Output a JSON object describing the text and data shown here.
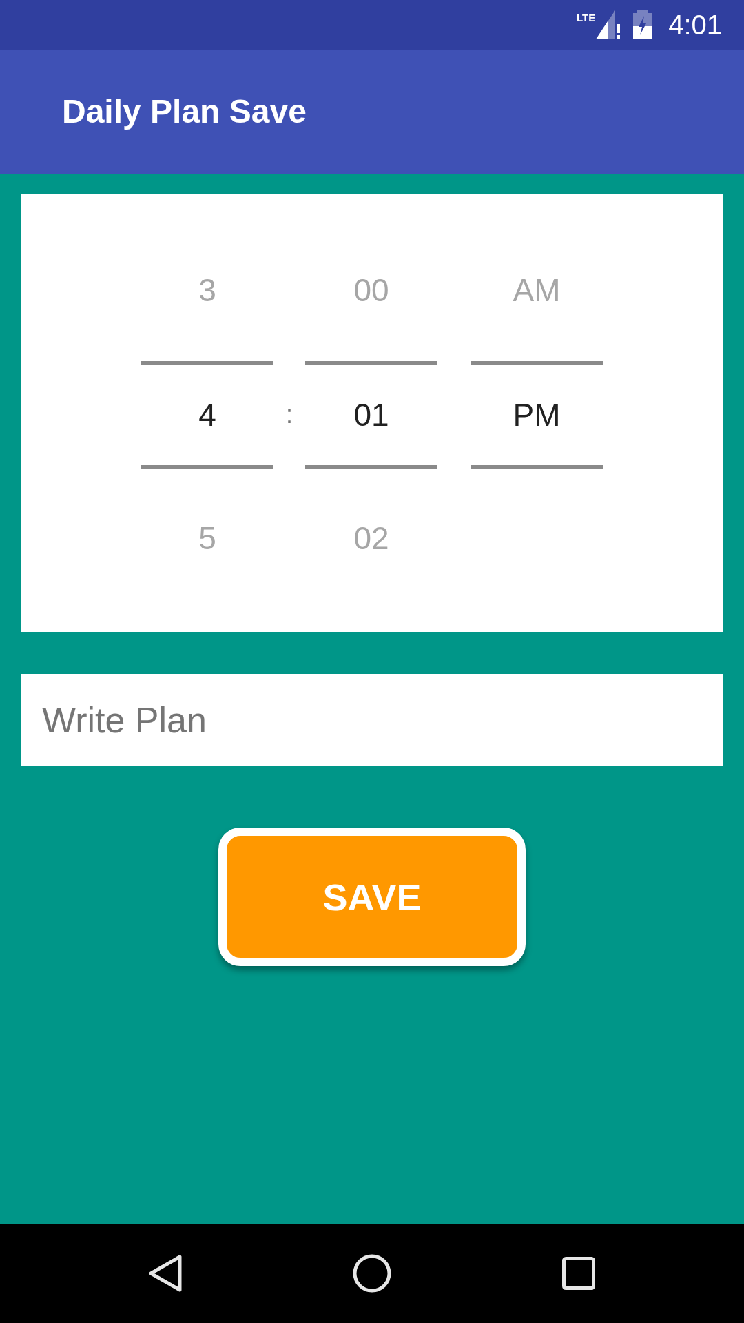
{
  "status_bar": {
    "network": "LTE",
    "time": "4:01"
  },
  "app_bar": {
    "title": "Daily Plan Save"
  },
  "time_picker": {
    "hour": {
      "above": "3",
      "value": "4",
      "below": "5"
    },
    "separator": ":",
    "minute": {
      "above": "00",
      "value": "01",
      "below": "02"
    },
    "period": {
      "above": "AM",
      "value": "PM"
    }
  },
  "plan_field": {
    "placeholder": "Write Plan"
  },
  "save_button": {
    "label": "SAVE"
  }
}
